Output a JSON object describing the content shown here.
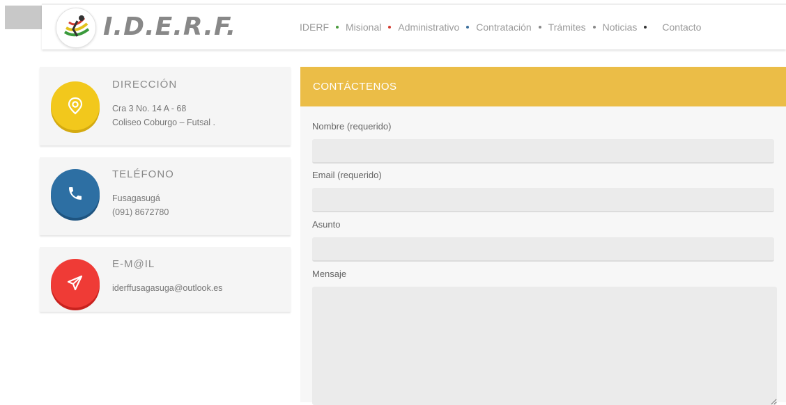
{
  "header": {
    "logo_text": "I.D.E.R.F.",
    "nav": [
      {
        "label": "IDERF",
        "dot_color": "#4a9a3c"
      },
      {
        "label": "Misional",
        "dot_color": "#d33a2f"
      },
      {
        "label": "Administrativo",
        "dot_color": "#3a6e9c"
      },
      {
        "label": "Contratación",
        "dot_color": "#888888"
      },
      {
        "label": "Trámites",
        "dot_color": "#888888"
      },
      {
        "label": "Noticias",
        "dot_color": "#333333"
      },
      {
        "label": "Contacto",
        "dot_color": null
      }
    ]
  },
  "cards": [
    {
      "title": "DIRECCIÓN",
      "lines": [
        "Cra 3 No. 14 A - 68",
        "Coliseo Coburgo – Futsal ."
      ],
      "color": "#f2c81c",
      "icon": "location-pin-icon"
    },
    {
      "title": "TELÉFONO",
      "lines": [
        "Fusagasugá",
        "(091) 8672780"
      ],
      "color": "#2d6fa3",
      "icon": "phone-icon"
    },
    {
      "title": "E-M@IL",
      "lines": [
        "iderffusagasuga@outlook.es"
      ],
      "color": "#ef3b36",
      "icon": "paper-plane-icon"
    }
  ],
  "form": {
    "heading": "CONTÁCTENOS",
    "name_label": "Nombre (requerido)",
    "email_label": "Email (requerido)",
    "subject_label": "Asunto",
    "message_label": "Mensaje",
    "name_value": "",
    "email_value": "",
    "subject_value": "",
    "message_value": ""
  },
  "colors": {
    "accent": "#ebbd47"
  }
}
